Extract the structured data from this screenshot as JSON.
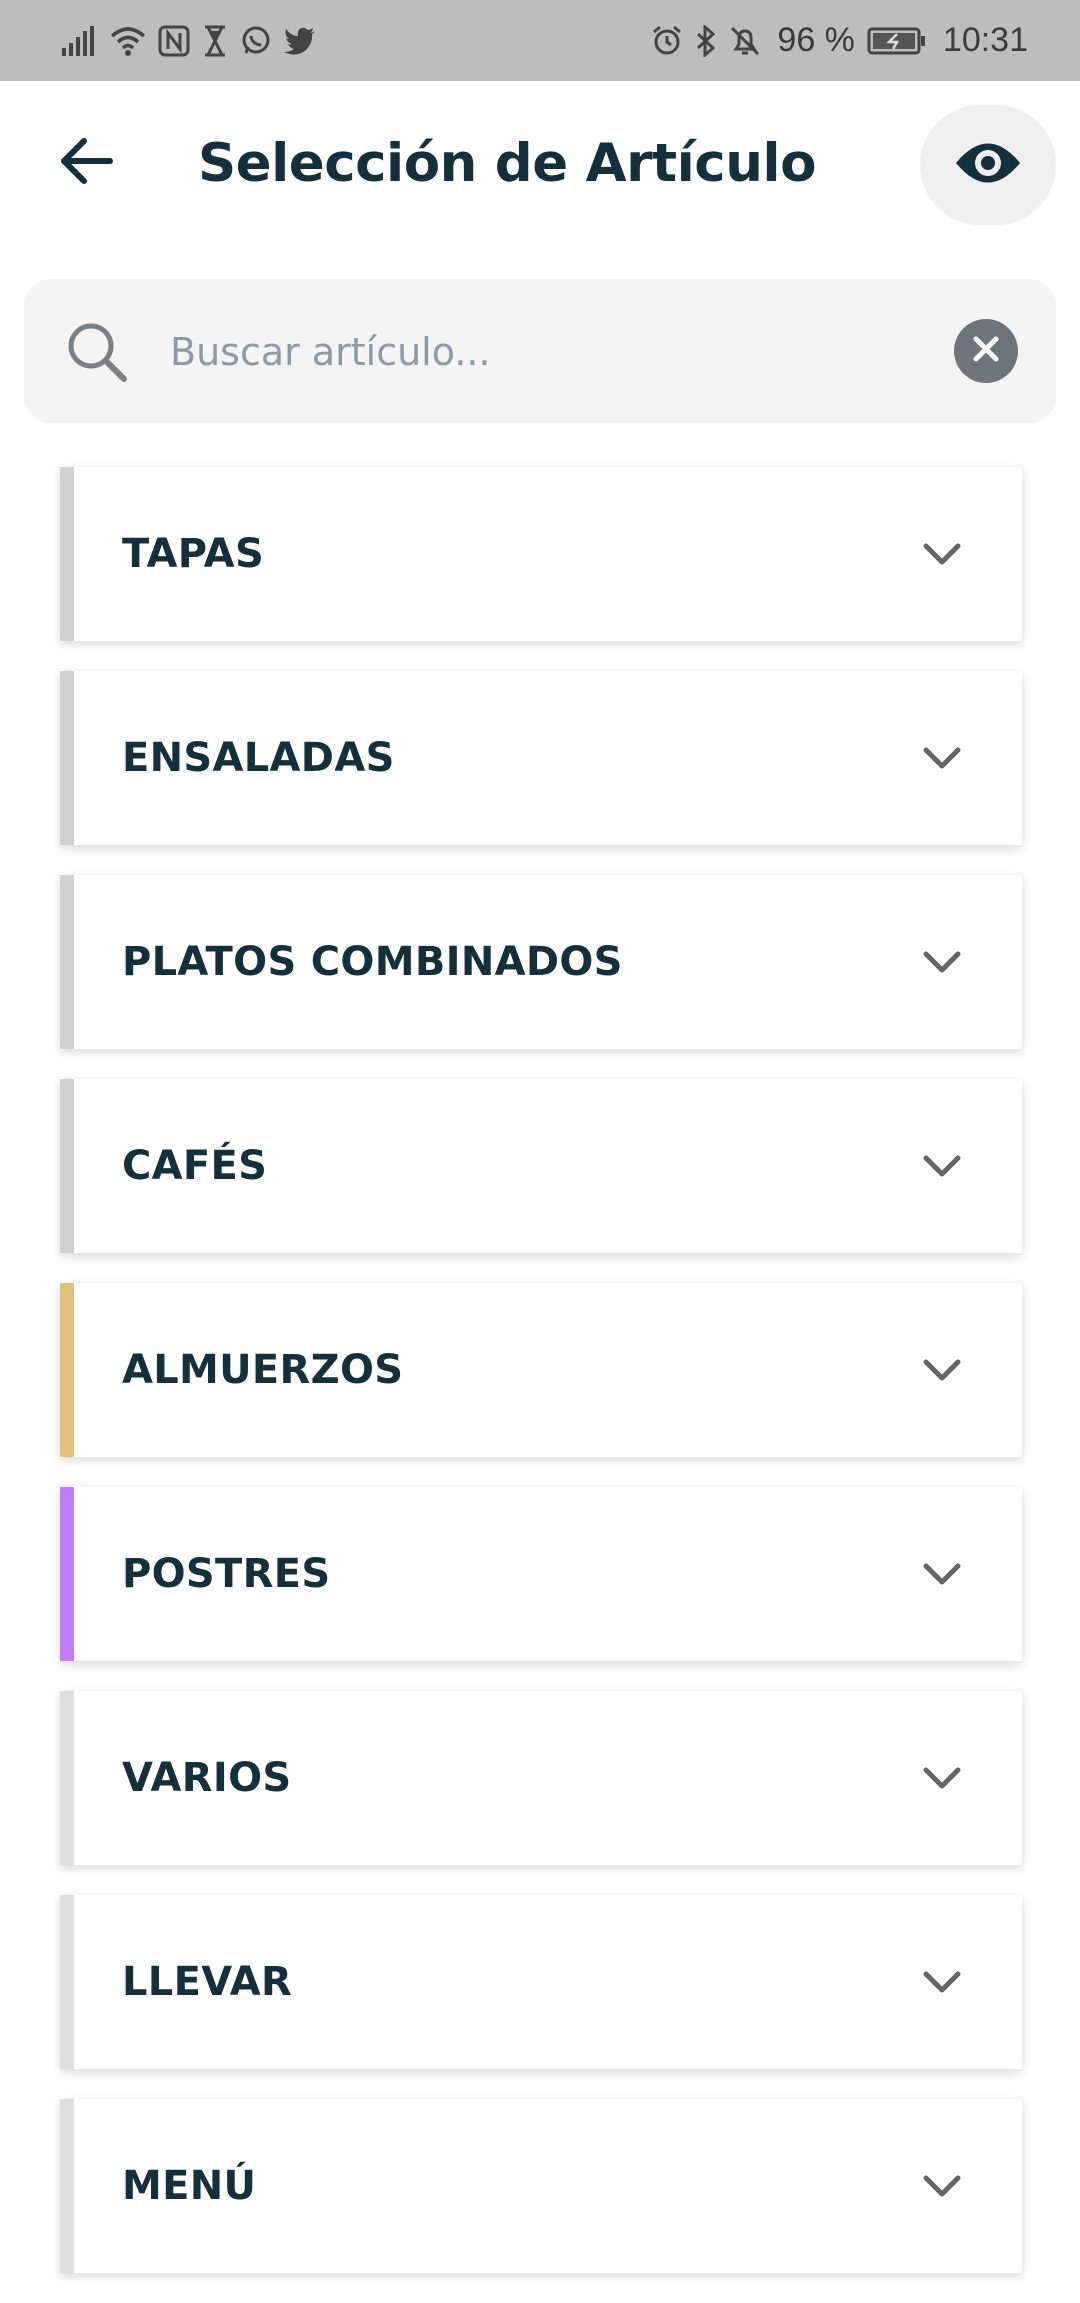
{
  "status_bar": {
    "icons_left": [
      "signal-icon",
      "wifi-icon",
      "nfc-icon",
      "hourglass-icon",
      "whatsapp-icon",
      "twitter-icon"
    ],
    "icons_right": [
      "alarm-icon",
      "bluetooth-icon",
      "bell-off-icon",
      "battery-charging-icon"
    ],
    "battery": "96 %",
    "time": "10:31"
  },
  "header": {
    "title": "Selección de Artículo",
    "back_icon": "arrow-left-icon",
    "view_icon": "eye-icon"
  },
  "search": {
    "placeholder": "Buscar artículo...",
    "value": "",
    "search_icon": "search-icon",
    "clear_icon": "clear-icon"
  },
  "categories": [
    {
      "label": "TAPAS",
      "accent": "#d0d0d0"
    },
    {
      "label": "ENSALADAS",
      "accent": "#d0d0d0"
    },
    {
      "label": "PLATOS COMBINADOS",
      "accent": "#d0d0d0"
    },
    {
      "label": "CAFÉS",
      "accent": "#d0d0d0"
    },
    {
      "label": "ALMUERZOS",
      "accent": "#e2c07c"
    },
    {
      "label": "POSTRES",
      "accent": "#c07df5"
    },
    {
      "label": "VARIOS",
      "accent": "#dedede"
    },
    {
      "label": "LLEVAR",
      "accent": "#dedede"
    },
    {
      "label": "MENÚ",
      "accent": "#dedede"
    }
  ],
  "colors": {
    "title_text": "#15303d",
    "status_bar_bg": "#bdbdbd",
    "search_bg": "#f4f4f4",
    "placeholder": "#8a9aa8"
  }
}
